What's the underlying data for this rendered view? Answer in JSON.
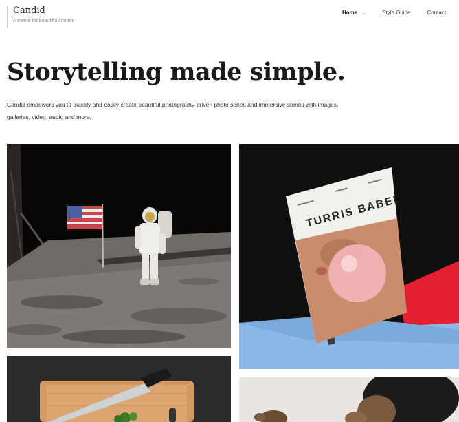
{
  "brand": {
    "title": "Candid",
    "tagline": "A theme for beautiful content"
  },
  "nav": {
    "items": [
      {
        "label": "Home",
        "active": true,
        "has_dropdown": true,
        "icon": "chevron-down-icon"
      },
      {
        "label": "Style Guide",
        "active": false
      },
      {
        "label": "Contact",
        "active": false
      }
    ]
  },
  "hero": {
    "title": "Storytelling made simple.",
    "description": "Candid empowers you to quickly and easily create beautiful photography-driven photo series and immersive stories with images, galleries, video, audio and more."
  },
  "gallery": {
    "items": [
      {
        "name": "moon-landing-photo"
      },
      {
        "name": "turris-babel-magazine-photo",
        "cover_text": "TURRIS BABEL"
      },
      {
        "name": "knife-cutting-board-photo"
      },
      {
        "name": "stuffed-toy-photo"
      }
    ]
  },
  "colors": {
    "background": "#ffffff",
    "text": "#222222",
    "muted": "#888888"
  }
}
